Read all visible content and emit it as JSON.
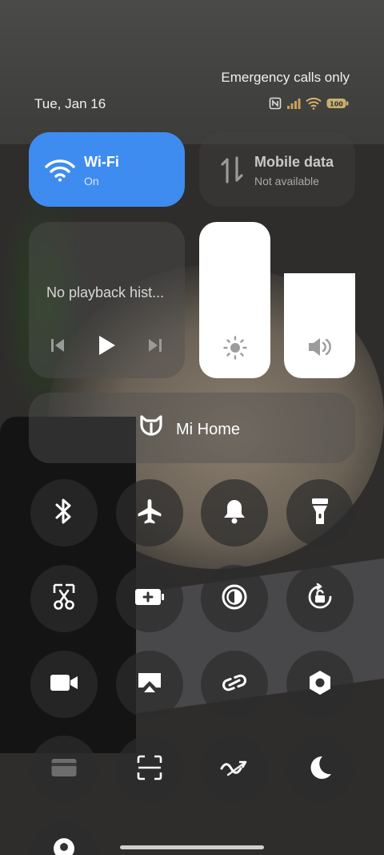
{
  "status": {
    "carrier_text": "Emergency calls only",
    "date": "Tue, Jan 16",
    "battery_level": "100",
    "icons": [
      "nfc-icon",
      "signal-icon",
      "wifi-icon",
      "battery-icon"
    ]
  },
  "wifi": {
    "title": "Wi-Fi",
    "state": "On",
    "active_color": "#3f8cf0"
  },
  "mobile_data": {
    "title": "Mobile data",
    "state": "Not available"
  },
  "media": {
    "title": "No playback hist..."
  },
  "brightness": {
    "level": 1.0
  },
  "volume": {
    "level": 0.67
  },
  "mi_home": {
    "label": "Mi Home"
  },
  "toggles": [
    {
      "name": "bluetooth",
      "icon": "bluetooth-icon"
    },
    {
      "name": "airplane-mode",
      "icon": "airplane-icon"
    },
    {
      "name": "ringer",
      "icon": "bell-icon"
    },
    {
      "name": "flashlight",
      "icon": "flashlight-icon"
    },
    {
      "name": "screenshot",
      "icon": "scissors-icon"
    },
    {
      "name": "battery-saver",
      "icon": "battery-plus-icon"
    },
    {
      "name": "dark-mode",
      "icon": "contrast-icon"
    },
    {
      "name": "auto-rotate",
      "icon": "rotate-lock-icon"
    },
    {
      "name": "screen-recorder",
      "icon": "video-icon"
    },
    {
      "name": "cast",
      "icon": "cast-icon"
    },
    {
      "name": "link",
      "icon": "link-icon"
    },
    {
      "name": "settings-shortcut",
      "icon": "hexagon-icon"
    },
    {
      "name": "card",
      "icon": "card-icon"
    },
    {
      "name": "scanner",
      "icon": "scan-icon"
    },
    {
      "name": "data-saver",
      "icon": "data-saver-icon"
    },
    {
      "name": "do-not-disturb",
      "icon": "moon-icon"
    },
    {
      "name": "location",
      "icon": "location-icon"
    }
  ]
}
